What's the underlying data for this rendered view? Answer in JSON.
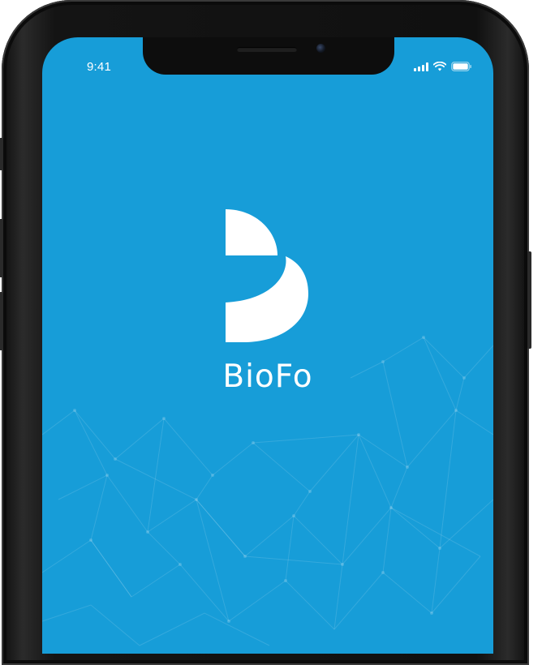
{
  "status_bar": {
    "time": "9:41",
    "icons": [
      "signal-icon",
      "wifi-icon",
      "battery-icon"
    ]
  },
  "splash": {
    "app_name": "BioFo",
    "logo": "biofo-logo-icon",
    "background_color": "#179dd8",
    "foreground_color": "#ffffff"
  }
}
